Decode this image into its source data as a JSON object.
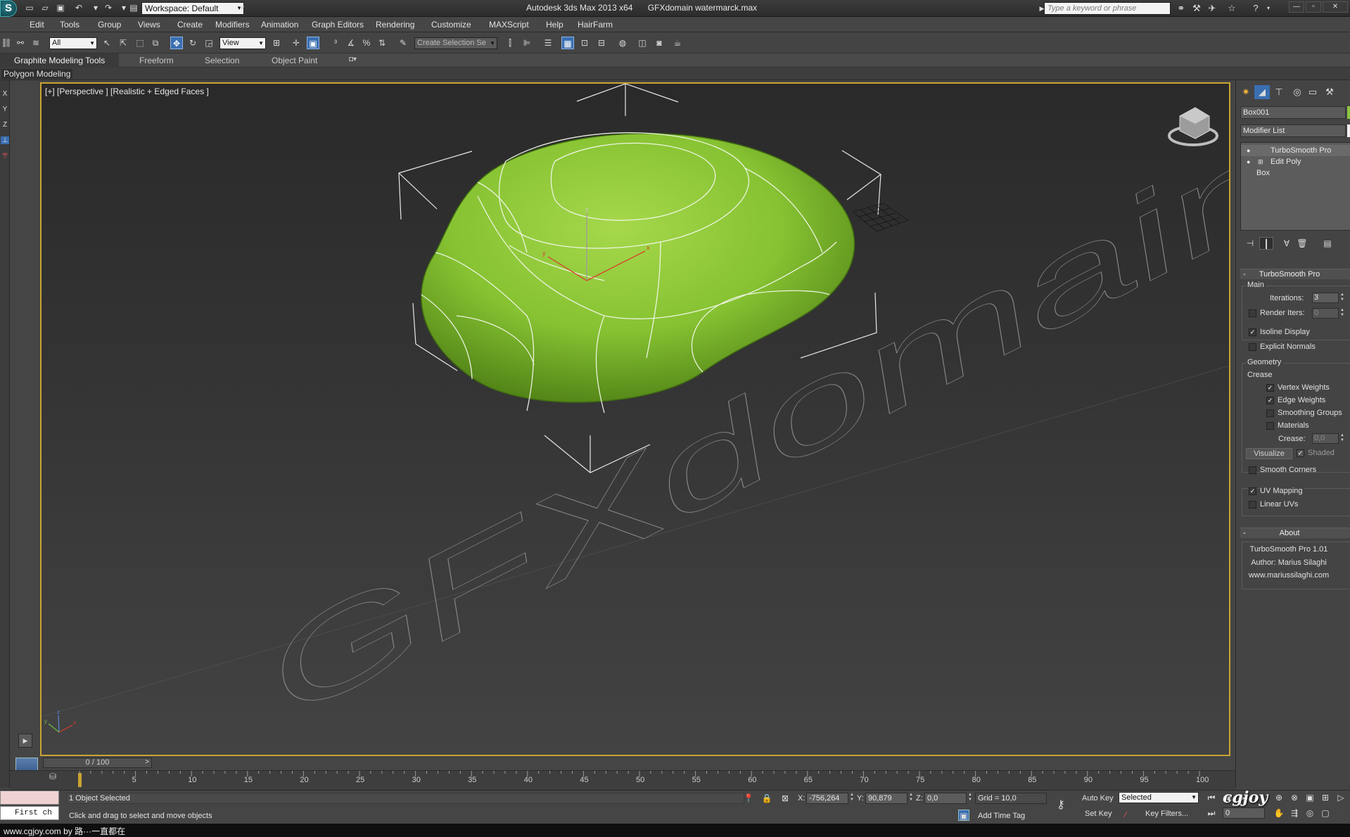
{
  "app": {
    "title": "Autodesk 3ds Max  2013 x64",
    "file": "GFXdomain watermarck.max",
    "logo_glyph": "S",
    "workspace_label": "Workspace: Default",
    "search_placeholder": "Type a keyword or phrase"
  },
  "menu": [
    "Edit",
    "Tools",
    "Group",
    "Views",
    "Create",
    "Modifiers",
    "Animation",
    "Graph Editors",
    "Rendering",
    "Customize",
    "MAXScript",
    "Help",
    "HairFarm"
  ],
  "toolbar": {
    "selection_filter": "All",
    "ref_coord": "View",
    "named_selection": "Create Selection Se"
  },
  "ribbon": {
    "tabs": [
      "Graphite Modeling Tools",
      "Freeform",
      "Selection",
      "Object Paint"
    ],
    "active_panel": "Polygon Modeling"
  },
  "viewport": {
    "label": "[+] [Perspective ] [Realistic + Edged Faces ]",
    "watermark": "GFXdomain",
    "axis_labels": {
      "x": "x",
      "y": "y",
      "z": "z"
    }
  },
  "command_panel": {
    "object_name": "Box001",
    "modifier_list": "Modifier List",
    "stack": [
      "TurboSmooth Pro",
      "Edit Poly",
      "Box"
    ],
    "turbosmooth": {
      "title": "TurboSmooth Pro",
      "main_label": "Main",
      "iterations_label": "Iterations:",
      "iterations_value": "3",
      "render_iters_label": "Render Iters:",
      "render_iters_value": "0",
      "render_iters_checked": false,
      "isoline_label": "Isoline Display",
      "isoline_checked": true,
      "explicit_normals_label": "Explicit Normals",
      "explicit_normals_checked": false,
      "geometry_label": "Geometry",
      "crease_label": "Crease",
      "vertex_weights_label": "Vertex Weights",
      "vertex_weights_checked": true,
      "edge_weights_label": "Edge Weights",
      "edge_weights_checked": true,
      "smoothing_groups_label": "Smoothing Groups",
      "smoothing_groups_checked": false,
      "materials_label": "Materials",
      "materials_checked": false,
      "crease_value_label": "Crease:",
      "crease_value": "0,0",
      "visualize_label": "Visualize",
      "shaded_label": "Shaded",
      "shaded_checked": true,
      "smooth_corners_label": "Smooth Corners",
      "smooth_corners_checked": false,
      "uv_mapping_label": "UV Mapping",
      "uv_mapping_checked": true,
      "linear_uvs_label": "Linear UVs",
      "linear_uvs_checked": false
    },
    "about": {
      "title": "About",
      "line1": "TurboSmooth Pro 1.01",
      "line2": "Author: Marius Silaghi",
      "line3": "www.mariussilaghi.com"
    }
  },
  "timeline": {
    "slider_label": "0 / 100",
    "prev": "<",
    "next": ">",
    "ticks": [
      "5",
      "10",
      "15",
      "20",
      "25",
      "30",
      "35",
      "40",
      "45",
      "50",
      "55",
      "60",
      "65",
      "70",
      "75",
      "80",
      "85",
      "90",
      "95",
      "100"
    ]
  },
  "status": {
    "maxscript_text": "First ch",
    "selection": "1 Object Selected",
    "prompt": "Click and drag to select and move objects",
    "x_label": "X:",
    "x_value": "-756,264",
    "y_label": "Y:",
    "y_value": "90,879",
    "z_label": "Z:",
    "z_value": "0,0",
    "grid": "Grid = 10,0",
    "add_time_tag": "Add Time Tag",
    "auto_key": "Auto Key",
    "set_key": "Set Key",
    "key_mode": "Selected",
    "key_filters": "Key Filters...",
    "frame_value": "0"
  },
  "credit": {
    "text": "www.cgjoy.com by 路···一直都在",
    "logo": "cgjoy"
  },
  "colors": {
    "object_green": "#8cc63f",
    "viewport_border": "#c9a432",
    "active_tool": "#3a6fb2"
  }
}
